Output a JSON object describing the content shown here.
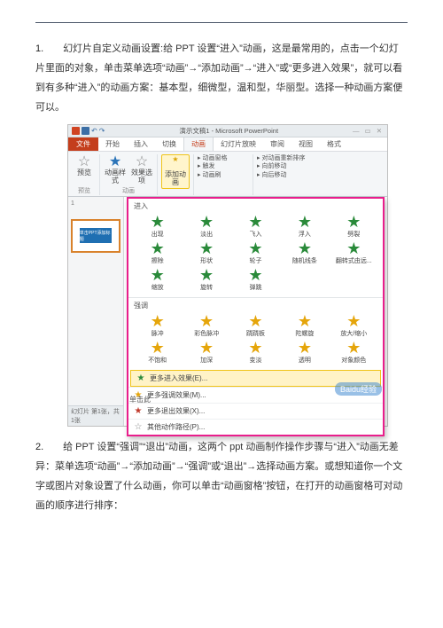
{
  "step1": {
    "num": "1.",
    "text": "幻灯片自定义动画设置:给 PPT 设置“进入”动画，这是最常用的，点击一个幻灯片里面的对象，单击菜单选项“动画”→“添加动画”→“进入”或“更多进入效果”，就可以看到有多种“进入”的动画方案：基本型，细微型，温和型，华丽型。选择一种动画方案便可以。"
  },
  "screenshot": {
    "window_title": "演示文稿1 - Microsoft PowerPoint",
    "win_controls": "— ▭ ✕",
    "tabs": {
      "file": "文件",
      "items": [
        "开始",
        "插入",
        "切换",
        "动画",
        "幻灯片放映",
        "审阅",
        "视图",
        "格式"
      ],
      "active_index": 3
    },
    "ribbon": {
      "preview": "预览",
      "anim_style": "动画样式",
      "effect_opts": "效果选项",
      "add_anim": "添加动画",
      "group_preview": "预览",
      "group_anim": "动画",
      "adv_lines": [
        "▸ 动画窗格",
        "▸ 触发",
        "▸ 动画刷"
      ],
      "timing_lines": [
        "▸ 对动画重新排序",
        "▸ 向前移动",
        "▸ 向后移动"
      ]
    },
    "slide_panel": {
      "label_tabs": "",
      "thumb_text": "单击PPT添加标题",
      "status": "幻灯片 第1张，共1张"
    },
    "gallery": {
      "section_enter": "进入",
      "enter_items": [
        "出现",
        "淡出",
        "飞入",
        "浮入",
        "劈裂",
        "擦除",
        "形状",
        "轮子",
        "随机线条",
        "翻转式由远...",
        "缩放",
        "旋转",
        "弹跳"
      ],
      "section_emph": "强调",
      "emph_items": [
        "脉冲",
        "彩色脉冲",
        "跷跷板",
        "陀螺旋",
        "放大/缩小",
        "不饱和",
        "加深",
        "变淡",
        "透明",
        "对象颜色"
      ],
      "more": [
        {
          "icon": "★",
          "label": "更多进入效果(E)...",
          "hl": true
        },
        {
          "icon": "★",
          "label": "更多强调效果(M)...",
          "hl": false
        },
        {
          "icon": "★",
          "label": "更多退出效果(X)...",
          "hl": false
        },
        {
          "icon": "☆",
          "label": "其他动作路径(P)...",
          "hl": false
        }
      ],
      "footnote": "单击此"
    },
    "watermark": "Baidu经验"
  },
  "step2": {
    "num": "2.",
    "text": "给 PPT 设置“强调”“退出”动画，这两个 ppt 动画制作操作步骤与“进入”动画无差异：菜单选项“动画”→“添加动画”→“强调”或“退出”→选择动画方案。或想知道你一个文字或图片对象设置了什么动画，你可以单击“动画窗格”按钮，在打开的动画窗格可对动画的顺序进行排序："
  }
}
